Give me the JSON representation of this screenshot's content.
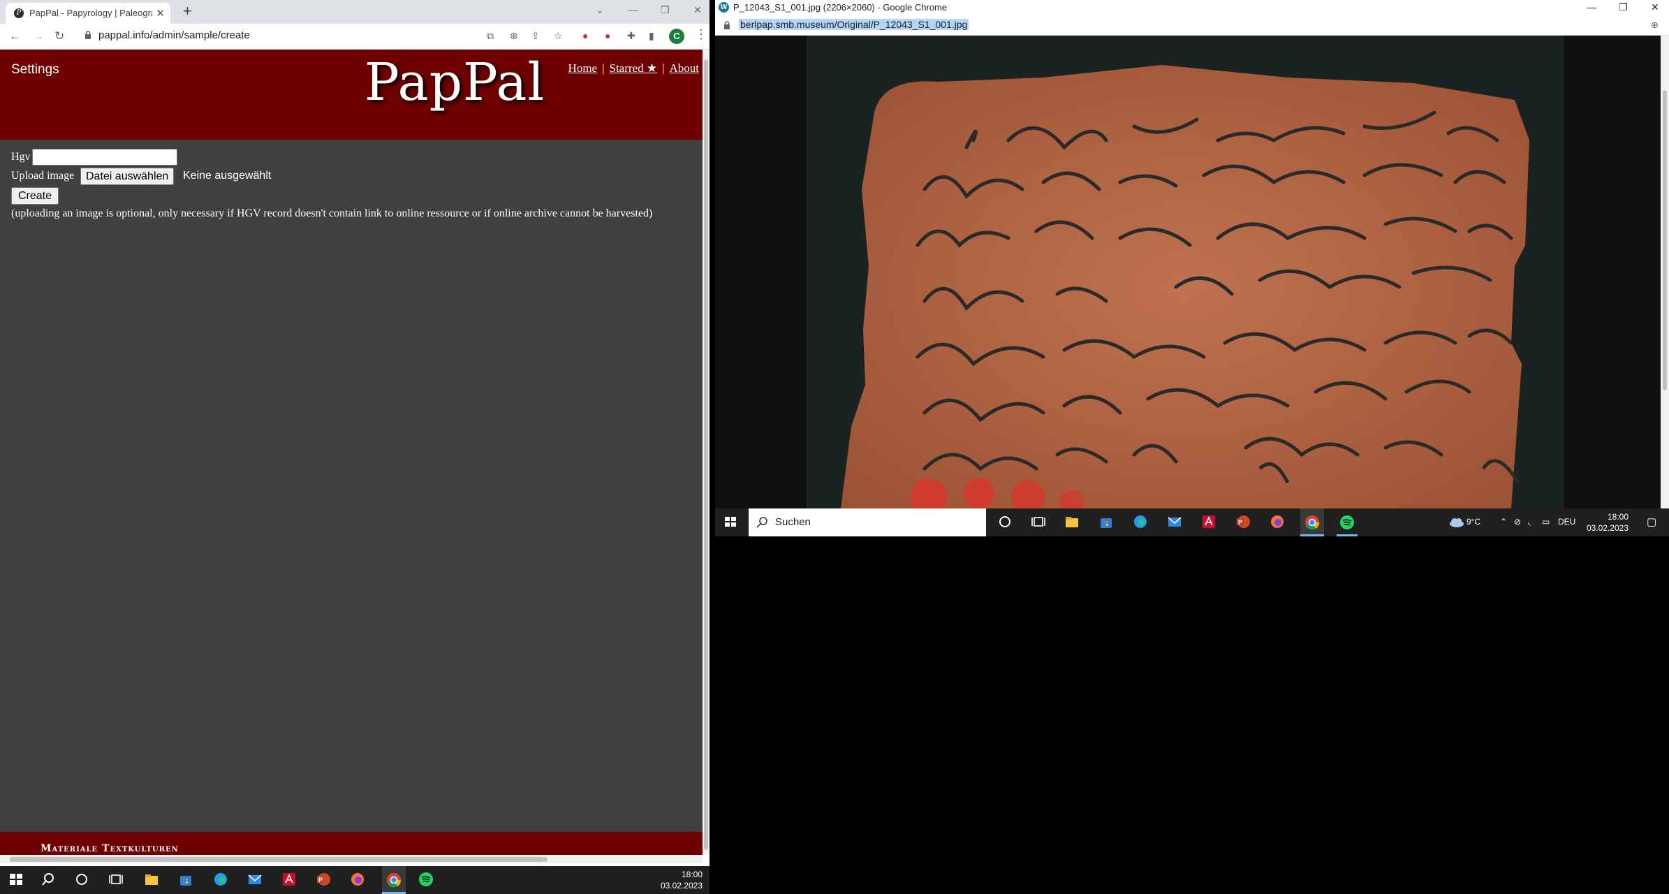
{
  "left_window": {
    "tab": {
      "title": "PapPal - Papyrology | Paleography",
      "favicon": "PapPal favicon"
    },
    "url": "pappal.info/admin/sample/create",
    "profile_initial": "C",
    "site": {
      "settings_label": "Settings",
      "logo": "PapPal",
      "nav": {
        "home": "Home",
        "starred": "Starred ★",
        "about": "About",
        "separator": "|"
      },
      "form": {
        "hgv_label": "Hgv",
        "hgv_value": "",
        "upload_label": "Upload image",
        "file_button": "Datei auswählen",
        "file_status": "Keine ausgewählt",
        "create_button": "Create",
        "note": "(uploading an image is optional, only necessary if HGV record doesn't contain link to online ressource or if online archive cannot be harvested)"
      },
      "footer_text": "Materiale Textkulturen"
    },
    "taskbar": {
      "time": "18:00",
      "date": "03.02.2023"
    }
  },
  "right_window": {
    "title": "P_12043_S1_001.jpg (2206×2060) - Google Chrome",
    "url": "berlpap.smb.museum/Original/P_12043_S1_001.jpg",
    "image_alt": "Ostracon fragment with Greek cursive writing",
    "taskbar": {
      "search_placeholder": "Suchen",
      "weather": "9°C",
      "language": "DEU",
      "time": "18:00",
      "date": "03.02.2023"
    }
  },
  "colors": {
    "site_header": "#6e0000",
    "site_body": "#404040",
    "taskbar": "#202020",
    "ostracon": "#b86a48",
    "ink": "#2b2a2a"
  },
  "icons": [
    "windows-start-icon",
    "search-icon",
    "cortana-icon",
    "task-view-icon",
    "file-explorer-icon",
    "ms-store-icon",
    "edge-icon",
    "mail-icon",
    "acrobat-icon",
    "powerpoint-icon",
    "firefox-icon",
    "chrome-icon",
    "spotify-icon"
  ]
}
